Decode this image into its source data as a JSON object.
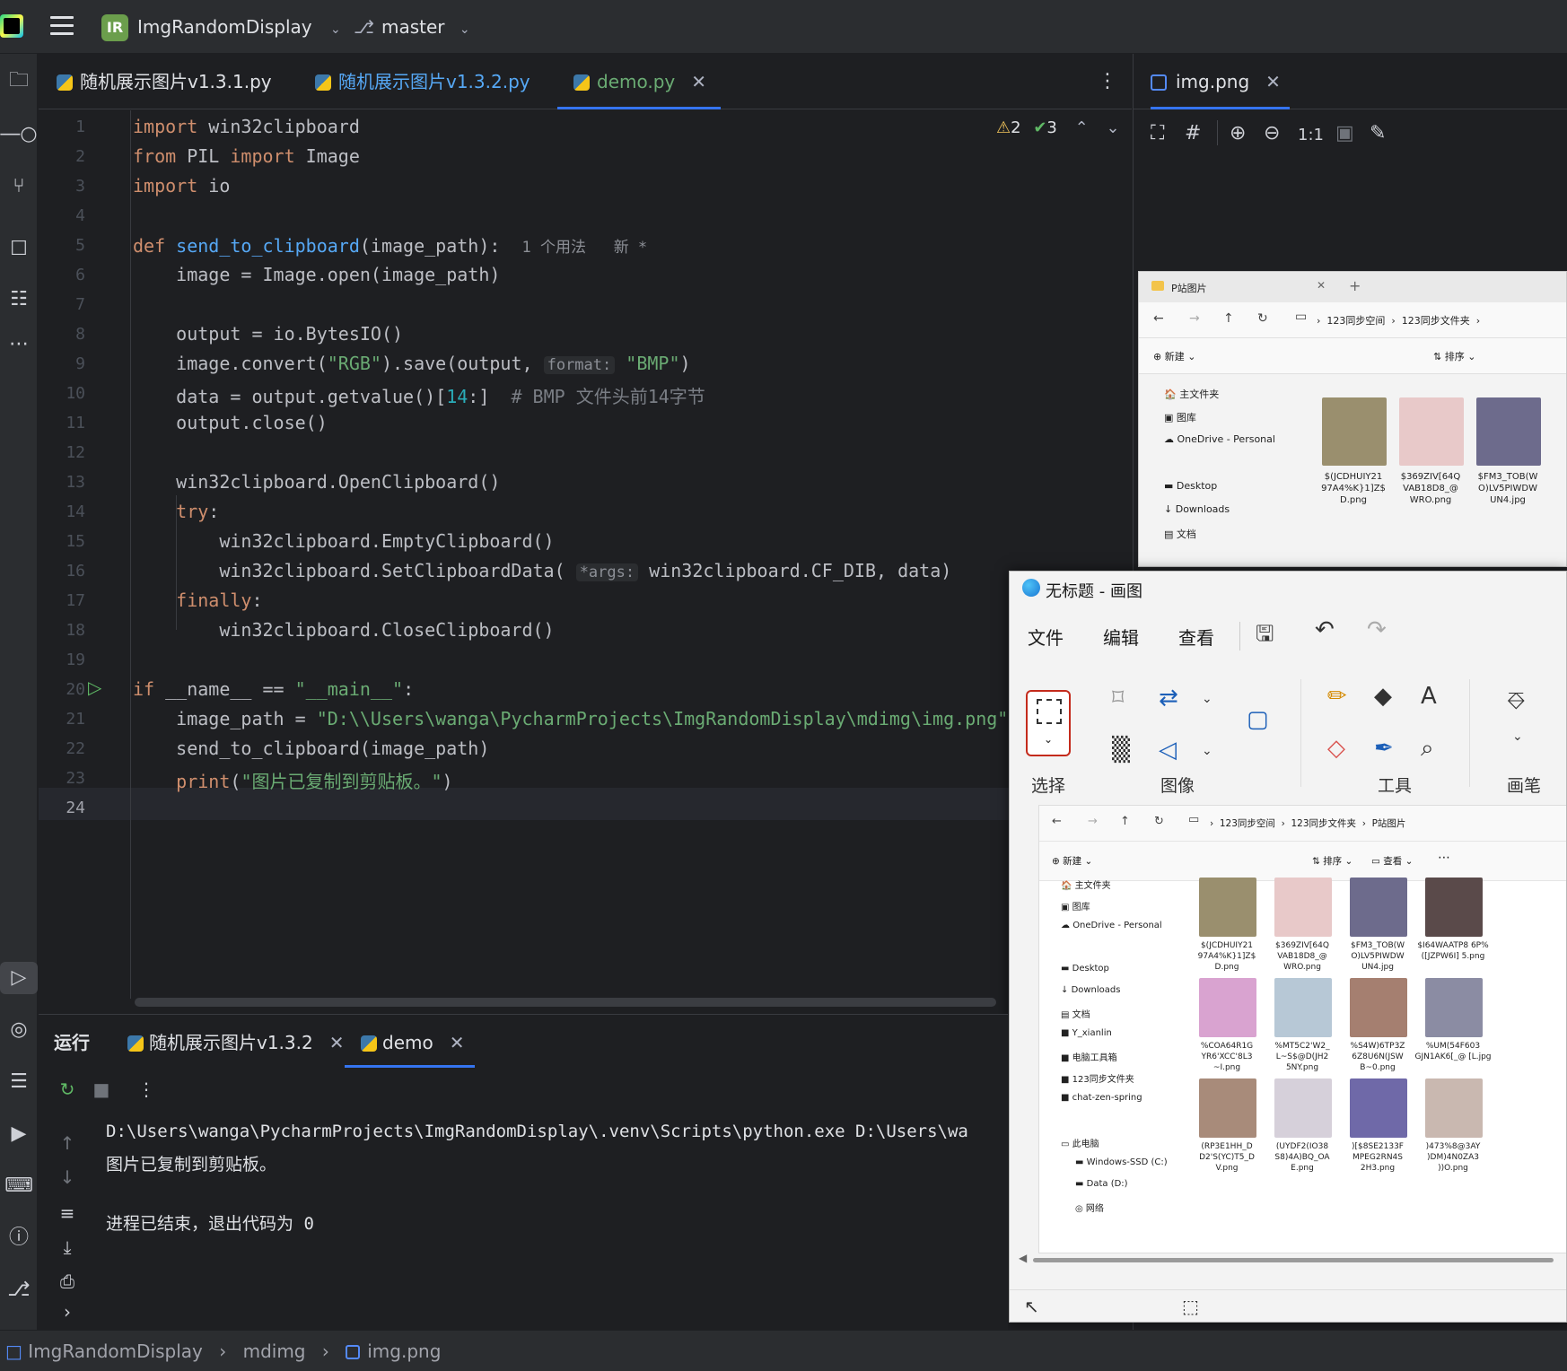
{
  "titlebar": {
    "project_badge": "IR",
    "project_name": "ImgRandomDisplay",
    "branch": "master"
  },
  "editor_tabs": [
    {
      "label": "随机展示图片v1.3.1.py",
      "color": "#dfe1e5"
    },
    {
      "label": "随机展示图片v1.3.2.py",
      "color": "#56a8f5"
    },
    {
      "label": "demo.py",
      "color": "#6aab73"
    }
  ],
  "inspections": {
    "warnings": "2",
    "ok": "3"
  },
  "line_numbers": [
    "1",
    "2",
    "3",
    "4",
    "5",
    "6",
    "7",
    "8",
    "9",
    "10",
    "11",
    "12",
    "13",
    "14",
    "15",
    "16",
    "17",
    "18",
    "19",
    "20",
    "21",
    "22",
    "23",
    "24"
  ],
  "code": {
    "l1_kw": "import",
    "l1_rest": " win32clipboard",
    "l2_kw1": "from",
    "l2_mod": " PIL ",
    "l2_kw2": "import",
    "l2_rest": " Image",
    "l3_kw": "import",
    "l3_rest": " io",
    "l5_kw": "def ",
    "l5_fn": "send_to_clipboard",
    "l5_rest": "(image_path):",
    "l5_usage": "1 个用法   新 *",
    "l6": "image = Image.open(image_path)",
    "l8": "output = io.BytesIO()",
    "l9_a": "image.convert(",
    "l9_s1": "\"RGB\"",
    "l9_b": ").save(output, ",
    "l9_hint": "format:",
    "l9_s2": "\"BMP\"",
    "l9_c": ")",
    "l10_a": "data = output.getvalue()[",
    "l10_n": "14",
    "l10_b": ":]  ",
    "l10_cmt": "# BMP 文件头前14字节",
    "l11": "output.close()",
    "l13": "win32clipboard.OpenClipboard()",
    "l14_kw": "try",
    "l14_rest": ":",
    "l15": "win32clipboard.EmptyClipboard()",
    "l16_a": "win32clipboard.SetClipboardData( ",
    "l16_hint": "*args:",
    "l16_b": " win32clipboard.CF_DIB, data)",
    "l17_kw": "finally",
    "l17_rest": ":",
    "l18": "win32clipboard.CloseClipboard()",
    "l20_kw": "if",
    "l20_a": " __name__ == ",
    "l20_s": "\"__main__\"",
    "l20_b": ":",
    "l21_a": "image_path = ",
    "l21_s": "\"D:\\\\Users\\wanga\\PycharmProjects\\ImgRandomDisplay\\mdimg\\img.png\"",
    "l22": "send_to_clipboard(image_path)",
    "l23_kw": "print",
    "l23_a": "(",
    "l23_s": "\"图片已复制到剪贴板。\"",
    "l23_b": ")"
  },
  "image_viewer": {
    "tab_label": "img.png",
    "zoom_label": "1:1"
  },
  "explorer_bg": {
    "title": "P站图片",
    "crumbs": [
      "123同步空间",
      "123同步文件夹"
    ],
    "new_label": "新建",
    "sort_label": "排序",
    "sidebar": [
      "主文件夹",
      "图库",
      "OneDrive - Personal",
      "Desktop",
      "Downloads",
      "文档"
    ],
    "files": [
      {
        "name": "$(JCDHUIY21 97A4%K}1]Z$ D.png",
        "color": "#9a8f6e"
      },
      {
        "name": "$369ZIV[64Q VAB18D8_@ WRO.png",
        "color": "#e8c9c9"
      },
      {
        "name": "$FM3_TOB(W O)LV5PIWDW UN4.jpg",
        "color": "#6d6b8c"
      }
    ]
  },
  "paint": {
    "title": "无标题 - 画图",
    "menu": [
      "文件",
      "编辑",
      "查看"
    ],
    "groups": [
      "选择",
      "图像",
      "工具",
      "画笔"
    ],
    "explorer": {
      "crumbs": [
        "123同步空间",
        "123同步文件夹",
        "P站图片"
      ],
      "new_label": "新建",
      "sort_label": "排序",
      "view_label": "查看",
      "sidebar": [
        "主文件夹",
        "图库",
        "OneDrive - Personal",
        "Desktop",
        "Downloads",
        "文档",
        "Y_xianlin",
        "电脑工具箱",
        "123同步文件夹",
        "chat-zen-spring",
        "此电脑",
        "Windows-SSD (C:)",
        "Data (D:)",
        "网络"
      ],
      "files": [
        {
          "name": "$(JCDHUIY21 97A4%K}1]Z$ D.png",
          "color": "#9a8f6e"
        },
        {
          "name": "$369ZIV[64Q VAB18D8_@ WRO.png",
          "color": "#e8c9c9"
        },
        {
          "name": "$FM3_TOB(W O)LV5PIWDW UN4.jpg",
          "color": "#6d6b8c"
        },
        {
          "name": "$I64WAATP8 6P%([JZPW6I] 5.png",
          "color": "#5a4a4a"
        },
        {
          "name": "%COA64R1G YR6'XCC'8L3 ~I.png",
          "color": "#d9a3d0"
        },
        {
          "name": "%MT5C2'W2_ L~S$@D(JH2 5NY.png",
          "color": "#b7c8d6"
        },
        {
          "name": "%S4W)6TP3Z 6Z8U6N(JSW B~0.png",
          "color": "#a57f70"
        },
        {
          "name": "%UM(54F603 GJN1AK6[_@ [L.jpg",
          "color": "#8b8ca3"
        },
        {
          "name": "(RP3E1HH_D D2'S(YC)T5_D V.png",
          "color": "#a88b7a"
        },
        {
          "name": "(UYDF2(IO38 S8)4A)BQ_OA E.png",
          "color": "#d6d0da"
        },
        {
          "name": ")[$8SE2133F MPEG2RN4S 2H3.png",
          "color": "#6f69a8"
        },
        {
          "name": ")473%8@3AY )DM)4N0ZA3 ))O.png",
          "color": "#c9b8b0"
        }
      ]
    }
  },
  "run_panel": {
    "label": "运行",
    "tabs": [
      "随机展示图片v1.3.2",
      "demo"
    ],
    "console": [
      "D:\\Users\\wanga\\PycharmProjects\\ImgRandomDisplay\\.venv\\Scripts\\python.exe D:\\Users\\wa",
      "图片已复制到剪贴板。",
      "",
      "进程已结束，退出代码为 0"
    ]
  },
  "statusbar": {
    "crumbs": [
      "ImgRandomDisplay",
      "mdimg",
      "img.png"
    ]
  }
}
